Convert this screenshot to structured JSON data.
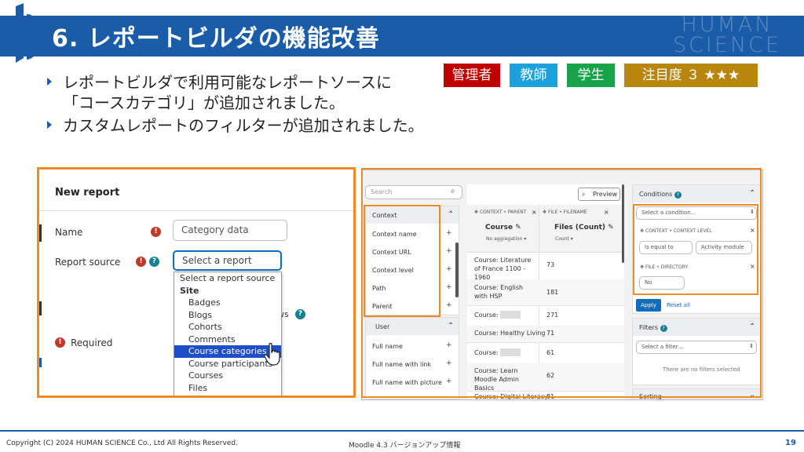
{
  "header": {
    "title": "6. レポートビルダの機能改善",
    "brand_line1": "HUMAN",
    "brand_line2": "SCIENCE"
  },
  "bullets": [
    {
      "lines": [
        "レポートビルダで利用可能なレポートソースに",
        "「コースカテゴリ」が追加されました。"
      ]
    },
    {
      "lines": [
        "カスタムレポートのフィルターが追加されました。"
      ]
    }
  ],
  "tags": [
    {
      "label": "管理者",
      "color": "#c00000"
    },
    {
      "label": "教師",
      "color": "#1ea0dc"
    },
    {
      "label": "学生",
      "color": "#16a34a"
    },
    {
      "label": "注目度 ３ ★★★",
      "color": "#b8860b"
    }
  ],
  "left_screenshot": {
    "dialog_title": "New report",
    "name_label": "Name",
    "name_value": "Category data",
    "source_label": "Report source",
    "source_select": "Select a report source ⇕",
    "dropdown": [
      {
        "label": "Select a report source",
        "bold": false,
        "indent": false,
        "selected": false
      },
      {
        "label": "Site",
        "bold": true,
        "indent": false,
        "selected": false
      },
      {
        "label": "Badges",
        "bold": false,
        "indent": true,
        "selected": false
      },
      {
        "label": "Blogs",
        "bold": false,
        "indent": true,
        "selected": false
      },
      {
        "label": "Cohorts",
        "bold": false,
        "indent": true,
        "selected": false
      },
      {
        "label": "Comments",
        "bold": false,
        "indent": true,
        "selected": false
      },
      {
        "label": "Course categories",
        "bold": false,
        "indent": true,
        "selected": true
      },
      {
        "label": "Course participants",
        "bold": false,
        "indent": true,
        "selected": false
      },
      {
        "label": "Courses",
        "bold": false,
        "indent": true,
        "selected": false
      },
      {
        "label": "Files",
        "bold": false,
        "indent": true,
        "selected": false
      }
    ],
    "partial_text": "ws",
    "required_label": "Required"
  },
  "right_screenshot": {
    "search_placeholder": "Search",
    "context_header": "Context",
    "context_items": [
      "Context name",
      "Context URL",
      "Context level",
      "Path",
      "Parent"
    ],
    "user_header": "User",
    "user_items": [
      "Full name",
      "Full name with link",
      "Full name with picture"
    ],
    "preview_label": "Preview",
    "col1_path": "CONTEXT • PARENT",
    "col1_title": "Course",
    "col1_agg": "No aggregation ▾",
    "col2_path": "FILE • FILENAME",
    "col2_title": "Files (Count)",
    "col2_agg": "Count ▾",
    "rows": [
      {
        "course": "Course: Literature of France 1100 - 1960",
        "count": "73"
      },
      {
        "course": "Course: English with HSP",
        "count": "181"
      },
      {
        "course": "Course:",
        "count": "271"
      },
      {
        "course": "Course: Healthy Living",
        "count": "71"
      },
      {
        "course": "Course:",
        "count": "61"
      },
      {
        "course": "Course: Learn Moodle Admin Basics",
        "count": "62"
      },
      {
        "course": "Course: Digital Literacy",
        "count": "81"
      }
    ],
    "conditions_title": "Conditions",
    "condition_select": "Select a condition...",
    "cond1_path": "CONTEXT • CONTEXT LEVEL",
    "cond1_op": "Is equal to",
    "cond1_val": "Activity module",
    "cond2_path": "FILE • DIRECTORY",
    "cond2_val": "No",
    "apply_label": "Apply",
    "reset_label": "Reset all",
    "filters_title": "Filters",
    "filter_select": "Select a filter...",
    "no_filters_text": "There are no filters selected",
    "sorting_title": "Sorting"
  },
  "footer": {
    "copyright": "Copyright (C) 2024 HUMAN SCIENCE Co., Ltd All Rights Reserved.",
    "center": "Moodle 4.3 バージョンアップ情報",
    "page": "19"
  },
  "colors": {
    "header_blue": "#1a5ca8",
    "highlight_orange": "#f08a24",
    "moodle_blue": "#0f6cbf"
  }
}
